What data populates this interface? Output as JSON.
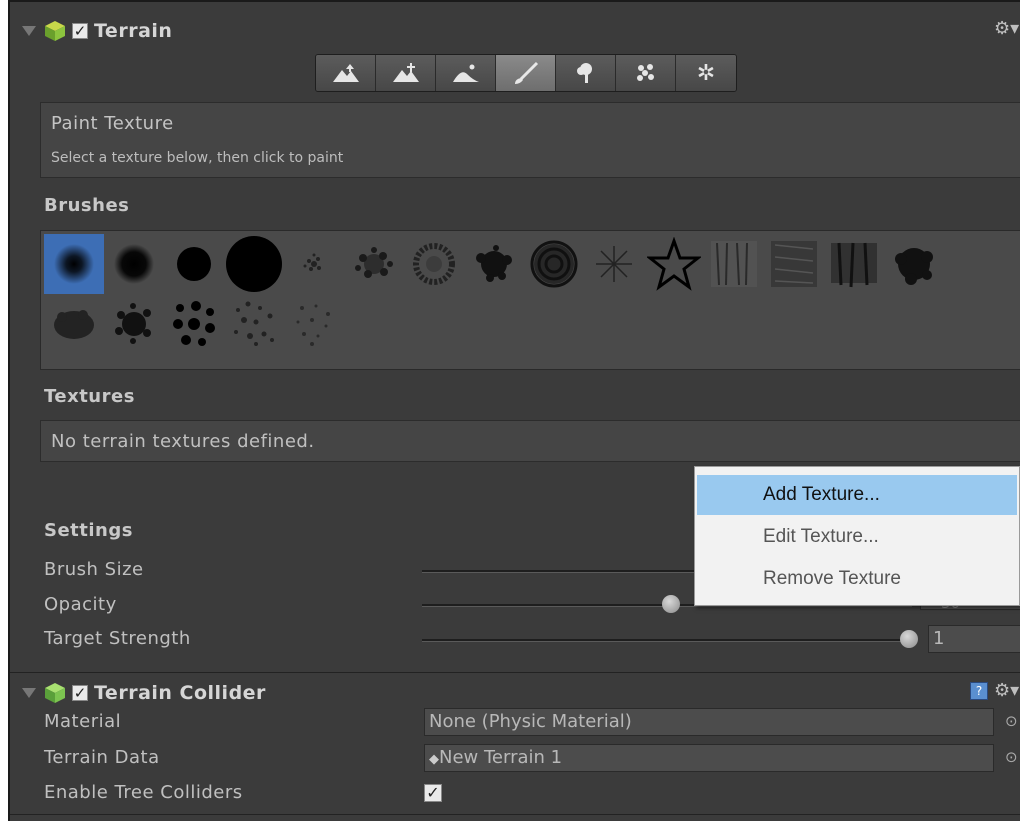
{
  "terrain": {
    "title": "Terrain",
    "enabled": true,
    "tools": [
      {
        "icon": "raise-lower-terrain-icon"
      },
      {
        "icon": "paint-height-icon"
      },
      {
        "icon": "smooth-height-icon"
      },
      {
        "icon": "paint-texture-icon",
        "active": true
      },
      {
        "icon": "place-trees-icon"
      },
      {
        "icon": "paint-details-icon"
      },
      {
        "icon": "terrain-settings-icon"
      }
    ],
    "info": {
      "title": "Paint Texture",
      "hint": "Select a texture below, then click to paint"
    },
    "brushes_heading": "Brushes",
    "textures_heading": "Textures",
    "textures_empty": "No terrain textures defined.",
    "settings_heading": "Settings",
    "settings": {
      "brush_size_label": "Brush Size",
      "opacity_label": "Opacity",
      "opacity_partial": "50",
      "target_strength_label": "Target Strength",
      "target_strength_value": "1"
    }
  },
  "context_menu": {
    "items": [
      {
        "label": "Add Texture...",
        "highlighted": true
      },
      {
        "label": "Edit Texture..."
      },
      {
        "label": "Remove Texture"
      }
    ]
  },
  "collider": {
    "title": "Terrain Collider",
    "enabled": true,
    "material_label": "Material",
    "material_value": "None (Physic Material)",
    "terrain_data_label": "Terrain Data",
    "terrain_data_value": "New Terrain 1",
    "tree_colliders_label": "Enable Tree Colliders",
    "tree_colliders_checked": true
  },
  "colors": {
    "panel_bg": "#3b3b3b",
    "menu_highlight": "#99c9ef",
    "selected_brush": "#3d6eb5"
  }
}
